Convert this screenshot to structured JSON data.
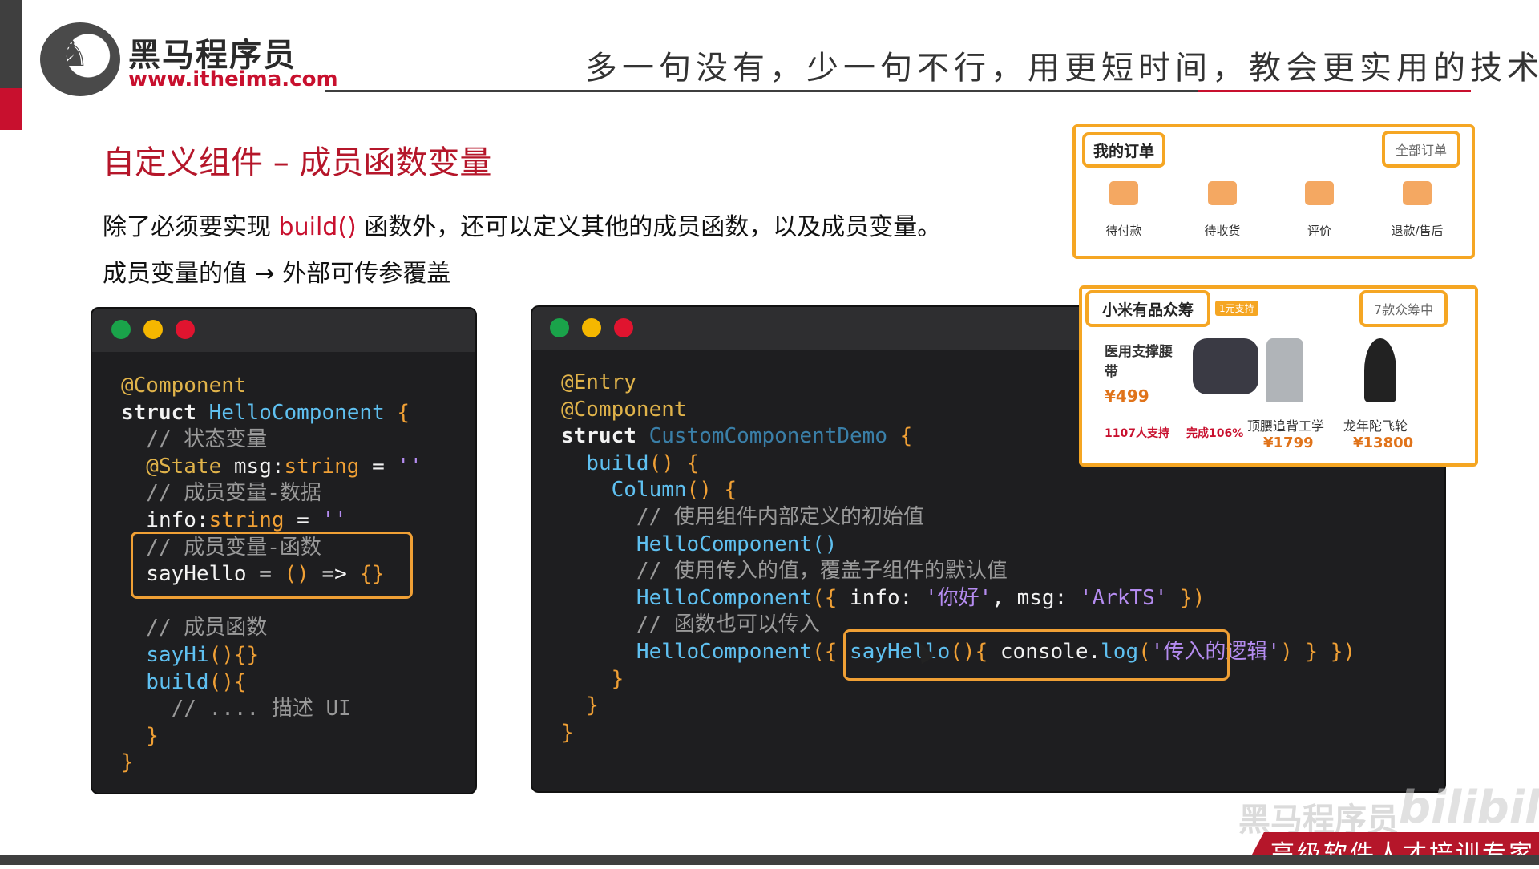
{
  "header": {
    "brand_name": "黑马程序员",
    "brand_url": "www.itheima.com",
    "slogan": "多一句没有，少一句不行，用更短时间，教会更实用的技术！"
  },
  "slide": {
    "title": "自定义组件 – 成员函数变量",
    "desc1_a": "除了必须要实现 ",
    "desc1_hl": "build()",
    "desc1_b": " 函数外，还可以定义其他的成员函数，以及成员变量。",
    "desc2": "成员变量的值 → 外部可传参覆盖"
  },
  "code_left": {
    "l1": "@Component",
    "l2_kw": "struct ",
    "l2_cls": "HelloComponent",
    "l2_br": " {",
    "l3": "  // 状态变量",
    "l4_a": "  @State",
    "l4_b": " msg:",
    "l4_c": "string",
    "l4_d": " = ",
    "l4_e": "''",
    "l5": "  // 成员变量-数据",
    "l6_a": "  info:",
    "l6_b": "string",
    "l6_c": " = ",
    "l6_d": "''",
    "l7": "  // 成员变量-函数",
    "l8_a": "  sayHello",
    "l8_b": " = ",
    "l8_c": "()",
    "l8_d": " => ",
    "l8_e": "{}",
    "l9": "  // 成员函数",
    "l10_a": "  sayHi",
    "l10_b": "(){}",
    "l11_a": "  build",
    "l11_b": "(){",
    "l12": "    // .... 描述 UI",
    "l13": "  }",
    "l14": "}"
  },
  "code_right": {
    "l1": "@Entry",
    "l2": "@Component",
    "l3_kw": "struct ",
    "l3_cls": "CustomComponentDemo",
    "l3_br": " {",
    "l4_a": "  build",
    "l4_b": "() {",
    "l5_a": "    Column",
    "l5_b": "() {",
    "l6": "      // 使用组件内部定义的初始值",
    "l7": "      HelloComponent()",
    "l8": "      // 使用传入的值，覆盖子组件的默认值",
    "l9_a": "      HelloComponent",
    "l9_b": "({ ",
    "l9_c": "info",
    "l9_d": ": ",
    "l9_e": "'你好'",
    "l9_f": ", ",
    "l9_g": "msg",
    "l9_h": ": ",
    "l9_i": "'ArkTS'",
    "l9_j": " })",
    "l10": "      // 函数也可以传入",
    "l11_a": "      HelloComponent",
    "l11_b": "({ ",
    "l11_c": "sayHello",
    "l11_d": "(){ ",
    "l11_e": "console",
    "l11_f": ".",
    "l11_g": "log",
    "l11_h": "(",
    "l11_i": "'传入的逻辑'",
    "l11_j": ") ",
    "l11_k": "} })",
    "l12": "    }",
    "l13": "  }",
    "l14": "}"
  },
  "orders_card": {
    "title": "我的订单",
    "all_orders": "全部订单",
    "items": [
      "待付款",
      "待收货",
      "评价",
      "退款/售后"
    ]
  },
  "crowdfund_card": {
    "title": "小米有品众筹",
    "tag": "1元支持",
    "count": "7款众筹中",
    "p1_name": "医用支撑腰带",
    "p1_price": "¥499",
    "p1_support": "1107人支持",
    "p1_done": "完成106%",
    "p2_name": "顶腰追背工学",
    "p2_price": "¥1799",
    "p3_name": "龙年陀飞轮",
    "p3_price": "¥13800"
  },
  "footer": {
    "slogan": "高级软件人才培训专家",
    "watermark": "黑马程序员",
    "bili": "bilibili"
  }
}
